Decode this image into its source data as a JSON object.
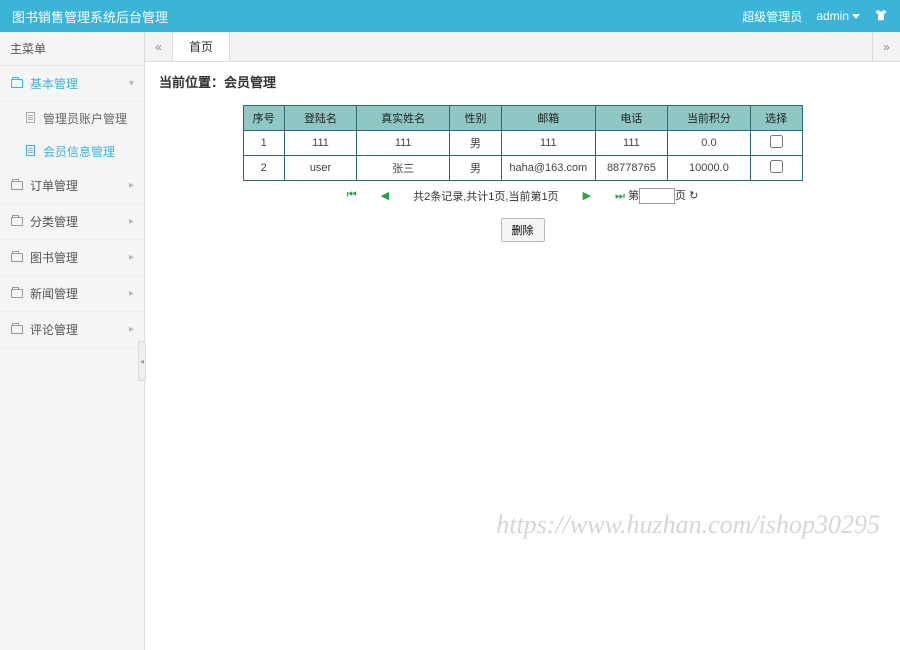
{
  "header": {
    "title": "图书销售管理系统后台管理",
    "role": "超级管理员",
    "user": "admin"
  },
  "sidebar": {
    "title": "主菜单",
    "items": [
      {
        "label": "基本管理",
        "expanded": true
      },
      {
        "label": "订单管理"
      },
      {
        "label": "分类管理"
      },
      {
        "label": "图书管理"
      },
      {
        "label": "新闻管理"
      },
      {
        "label": "评论管理"
      }
    ],
    "submenu": [
      {
        "label": "管理员账户管理"
      },
      {
        "label": "会员信息管理",
        "active": true
      }
    ]
  },
  "tabs": {
    "home": "首页"
  },
  "breadcrumb": {
    "prefix": "当前位置：",
    "current": "会员管理"
  },
  "table": {
    "headers": [
      "序号",
      "登陆名",
      "真实姓名",
      "性别",
      "邮箱",
      "电话",
      "当前积分",
      "选择"
    ],
    "rows": [
      {
        "idx": "1",
        "login": "111",
        "name": "111",
        "gender": "男",
        "email": "111",
        "phone": "111",
        "points": "0.0"
      },
      {
        "idx": "2",
        "login": "user",
        "name": "张三",
        "gender": "男",
        "email": "haha@163.com",
        "phone": "88778765",
        "points": "10000.0"
      }
    ]
  },
  "pager": {
    "summary": "共2条记录,共计1页,当前第1页",
    "prefix": "第",
    "suffix": "页"
  },
  "actions": {
    "delete": "删除"
  },
  "watermark": "https://www.huzhan.com/ishop30295"
}
